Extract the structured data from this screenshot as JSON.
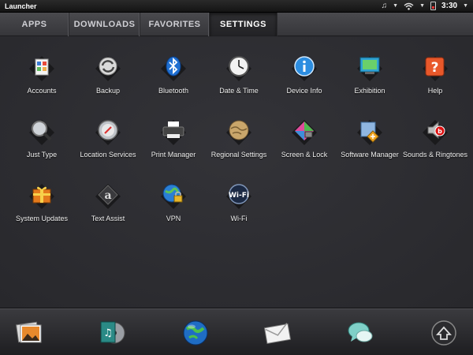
{
  "status": {
    "title": "Launcher",
    "time": "3:30",
    "icons": [
      "music-note-icon",
      "wifi-icon",
      "battery-icon"
    ]
  },
  "tabs": [
    {
      "label": "APPS",
      "active": false
    },
    {
      "label": "DOWNLOADS",
      "active": false
    },
    {
      "label": "FAVORITES",
      "active": false
    },
    {
      "label": "SETTINGS",
      "active": true
    }
  ],
  "apps": [
    {
      "label": "Accounts",
      "icon": "accounts-icon"
    },
    {
      "label": "Backup",
      "icon": "backup-icon"
    },
    {
      "label": "Bluetooth",
      "icon": "bluetooth-icon"
    },
    {
      "label": "Date & Time",
      "icon": "clock-icon"
    },
    {
      "label": "Device Info",
      "icon": "info-icon"
    },
    {
      "label": "Exhibition",
      "icon": "exhibition-icon"
    },
    {
      "label": "Help",
      "icon": "help-icon"
    },
    {
      "label": "Just Type",
      "icon": "magnifier-icon"
    },
    {
      "label": "Location Services",
      "icon": "compass-icon"
    },
    {
      "label": "Print Manager",
      "icon": "printer-icon"
    },
    {
      "label": "Regional Settings",
      "icon": "globe-icon"
    },
    {
      "label": "Screen & Lock",
      "icon": "screen-lock-icon"
    },
    {
      "label": "Software Manager",
      "icon": "software-manager-icon"
    },
    {
      "label": "Sounds & Ringtones",
      "icon": "speaker-icon"
    },
    {
      "label": "System Updates",
      "icon": "gift-icon"
    },
    {
      "label": "Text Assist",
      "icon": "text-assist-icon"
    },
    {
      "label": "VPN",
      "icon": "vpn-globe-lock-icon"
    },
    {
      "label": "Wi-Fi",
      "icon": "wifi-badge-icon"
    }
  ],
  "dock": [
    {
      "icon": "photos-icon"
    },
    {
      "icon": "music-icon"
    },
    {
      "icon": "web-browser-icon"
    },
    {
      "icon": "email-icon"
    },
    {
      "icon": "messaging-icon"
    },
    {
      "icon": "launcher-up-icon"
    }
  ],
  "colors": {
    "background": "#2b2b2f",
    "tab_active": "#232326",
    "battery_low": "#e33333"
  }
}
